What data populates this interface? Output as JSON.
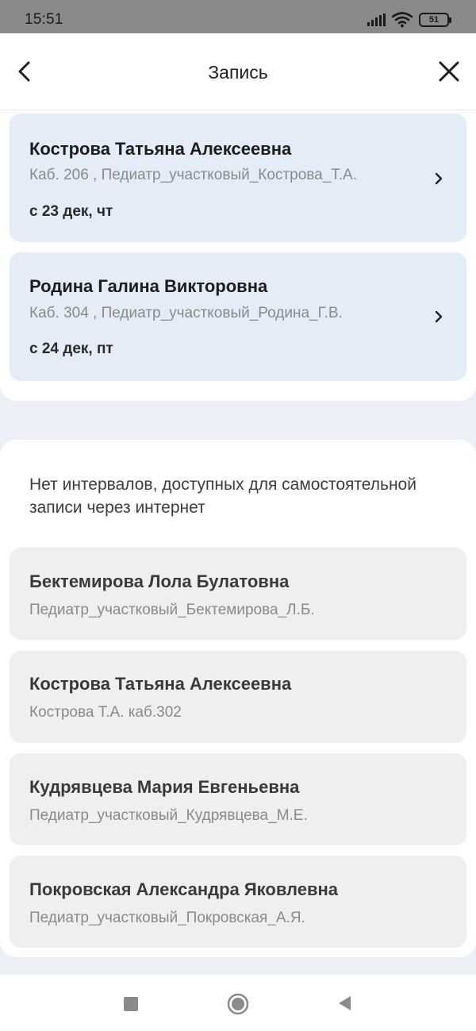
{
  "status_bar": {
    "time": "15:51",
    "battery": "51",
    "icons": [
      "signal-icon",
      "wifi-icon",
      "battery-icon"
    ]
  },
  "header": {
    "title": "Запись",
    "back_icon": "chevron-left-icon",
    "close_icon": "close-icon"
  },
  "available_doctors": [
    {
      "name": "Кострова Татьяна Алексеевна",
      "details": "Каб. 206 , Педиатр_участковый_Кострова_Т.А.",
      "date": "с 23 дек, чт"
    },
    {
      "name": "Родина Галина Викторовна",
      "details": "Каб. 304 , Педиатр_участковый_Родина_Г.В.",
      "date": "с 24 дек, пт"
    }
  ],
  "unavailable": {
    "notice": "Нет интервалов, доступных для самостоятельной записи через интернет",
    "doctors": [
      {
        "name": "Бектемирова Лола Булатовна",
        "details": "Педиатр_участковый_Бектемирова_Л.Б."
      },
      {
        "name": "Кострова Татьяна Алексеевна",
        "details": "Кострова Т.А. каб.302"
      },
      {
        "name": "Кудрявцева Мария Евгеньевна",
        "details": "Педиатр_участковый_Кудрявцева_М.Е."
      },
      {
        "name": "Покровская Александра Яковлевна",
        "details": "Педиатр_участковый_Покровская_А.Я."
      }
    ]
  },
  "colors": {
    "card_available": "#e4ecf8",
    "card_unavailable": "#efefef",
    "background": "#eceff6",
    "status_bar": "#8a8a8a"
  }
}
